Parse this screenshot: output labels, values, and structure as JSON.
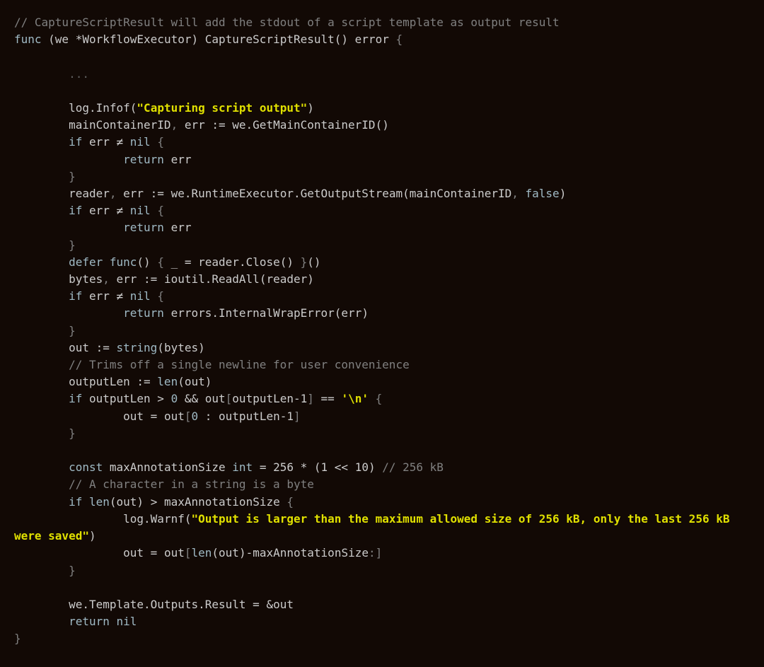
{
  "code": {
    "comment_header": "// CaptureScriptResult will add the stdout of a script template as output result",
    "kw_func": "func",
    "receiver_open": " (we ",
    "star": "*",
    "receiver_type": "WorkflowExecutor",
    "receiver_close": ") ",
    "method_name": "CaptureScriptResult",
    "method_paren": "()",
    "ret_type": " error ",
    "brace_open": "{",
    "ellipsis": "...",
    "log_call1a": "log",
    "dot": ".",
    "log_call1b": "Infof",
    "paren_open": "(",
    "str_capturing": "\"Capturing script output\"",
    "paren_close": ")",
    "mainContainerID": "mainContainerID",
    "comma_sp": ", ",
    "err": "err",
    "walrus": " := ",
    "we": "we",
    "getMain": "GetMainContainerID",
    "if": "if",
    "neq": " ≠ ",
    "nil": "nil",
    "return": "return",
    "reader": "reader",
    "runtime": "RuntimeExecutor",
    "getOutput": "GetOutputStream",
    "false": "false",
    "defer": "defer",
    "func_lit": "func",
    "underscore": "_",
    "eq": " = ",
    "close": "Close",
    "bytes": "bytes",
    "ioutil": "ioutil",
    "readall": "ReadAll",
    "errors": "errors",
    "wrap": "InternalWrapError",
    "out": "out",
    "string_fn": "string",
    "comment_trim": "// Trims off a single newline for user convenience",
    "outputLen": "outputLen",
    "len": "len",
    "gt": " > ",
    "zero": "0",
    "and": " && ",
    "minus1": "-1",
    "eqeq": " == ",
    "char_nl": "'\\n'",
    "colon": " : ",
    "const": "const",
    "maxAnn": "maxAnnotationSize",
    "int": "int",
    "eq_256": " = 256 ",
    "star_op": "* ",
    "one_shift": "(1 << 10)",
    "comment_256": " // 256 kB",
    "comment_char": "// A character in a string is a byte",
    "warnf": "Warnf",
    "str_warn": "\"Output is larger than the maximum allowed size of 256 kB, only the last 256 kB were saved\"",
    "slice_colon": ":",
    "template": "Template",
    "outputs": "Outputs",
    "result": "Result",
    "amp": "&",
    "brace_close": "}"
  }
}
